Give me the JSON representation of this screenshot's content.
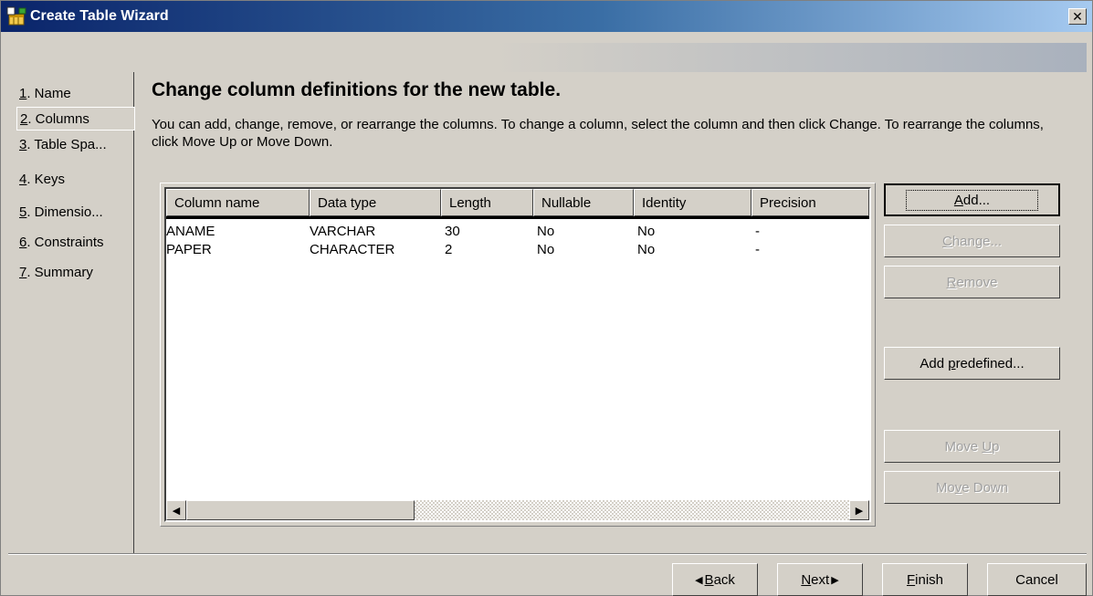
{
  "window": {
    "title": "Create Table Wizard",
    "close_symbol": "✕"
  },
  "nav": {
    "items": [
      {
        "num": "1",
        "label": ". Name"
      },
      {
        "num": "2",
        "label": ". Columns"
      },
      {
        "num": "3",
        "label": ". Table Spa..."
      },
      {
        "num": "4",
        "label": ". Keys"
      },
      {
        "num": "5",
        "label": ". Dimensio..."
      },
      {
        "num": "6",
        "label": ". Constraints"
      },
      {
        "num": "7",
        "label": ". Summary"
      }
    ],
    "active_index": 1
  },
  "main": {
    "heading": "Change column definitions for the new table.",
    "description": "You can add, change, remove, or rearrange the columns. To change a column, select the column and then click Change. To rearrange the columns, click Move Up or Move Down."
  },
  "table": {
    "columns": [
      "Column name",
      "Data type",
      "Length",
      "Nullable",
      "Identity",
      "Precision"
    ],
    "rows": [
      [
        "ANAME",
        "VARCHAR",
        "30",
        "No",
        "No",
        "-"
      ],
      [
        "PAPER",
        "CHARACTER",
        "2",
        "No",
        "No",
        "-"
      ]
    ]
  },
  "buttons": {
    "add": {
      "pre": "",
      "key": "A",
      "post": "dd..."
    },
    "change": {
      "pre": "",
      "key": "C",
      "post": "hange..."
    },
    "remove": {
      "pre": "",
      "key": "R",
      "post": "emove"
    },
    "add_predefined": {
      "pre": "Add ",
      "key": "p",
      "post": "redefined..."
    },
    "move_up": {
      "pre": "Move ",
      "key": "U",
      "post": "p"
    },
    "move_down": {
      "pre": "Mo",
      "key": "v",
      "post": "e Down"
    }
  },
  "footer": {
    "back": {
      "arrow": "◀",
      "key": "B",
      "post": "ack"
    },
    "next": {
      "key": "N",
      "post": "ext",
      "arrow": "▶"
    },
    "finish": {
      "key": "F",
      "post": "inish"
    },
    "cancel": "Cancel"
  },
  "colors": {
    "title_start": "#0a246a",
    "title_end": "#a6caf0",
    "face": "#d4d0c8",
    "disabled_text": "#a0a0a0"
  },
  "icons": {
    "window": "wizard-table-icon",
    "close": "close-icon",
    "scroll_left": "arrow-left-icon",
    "scroll_right": "arrow-right-icon"
  }
}
